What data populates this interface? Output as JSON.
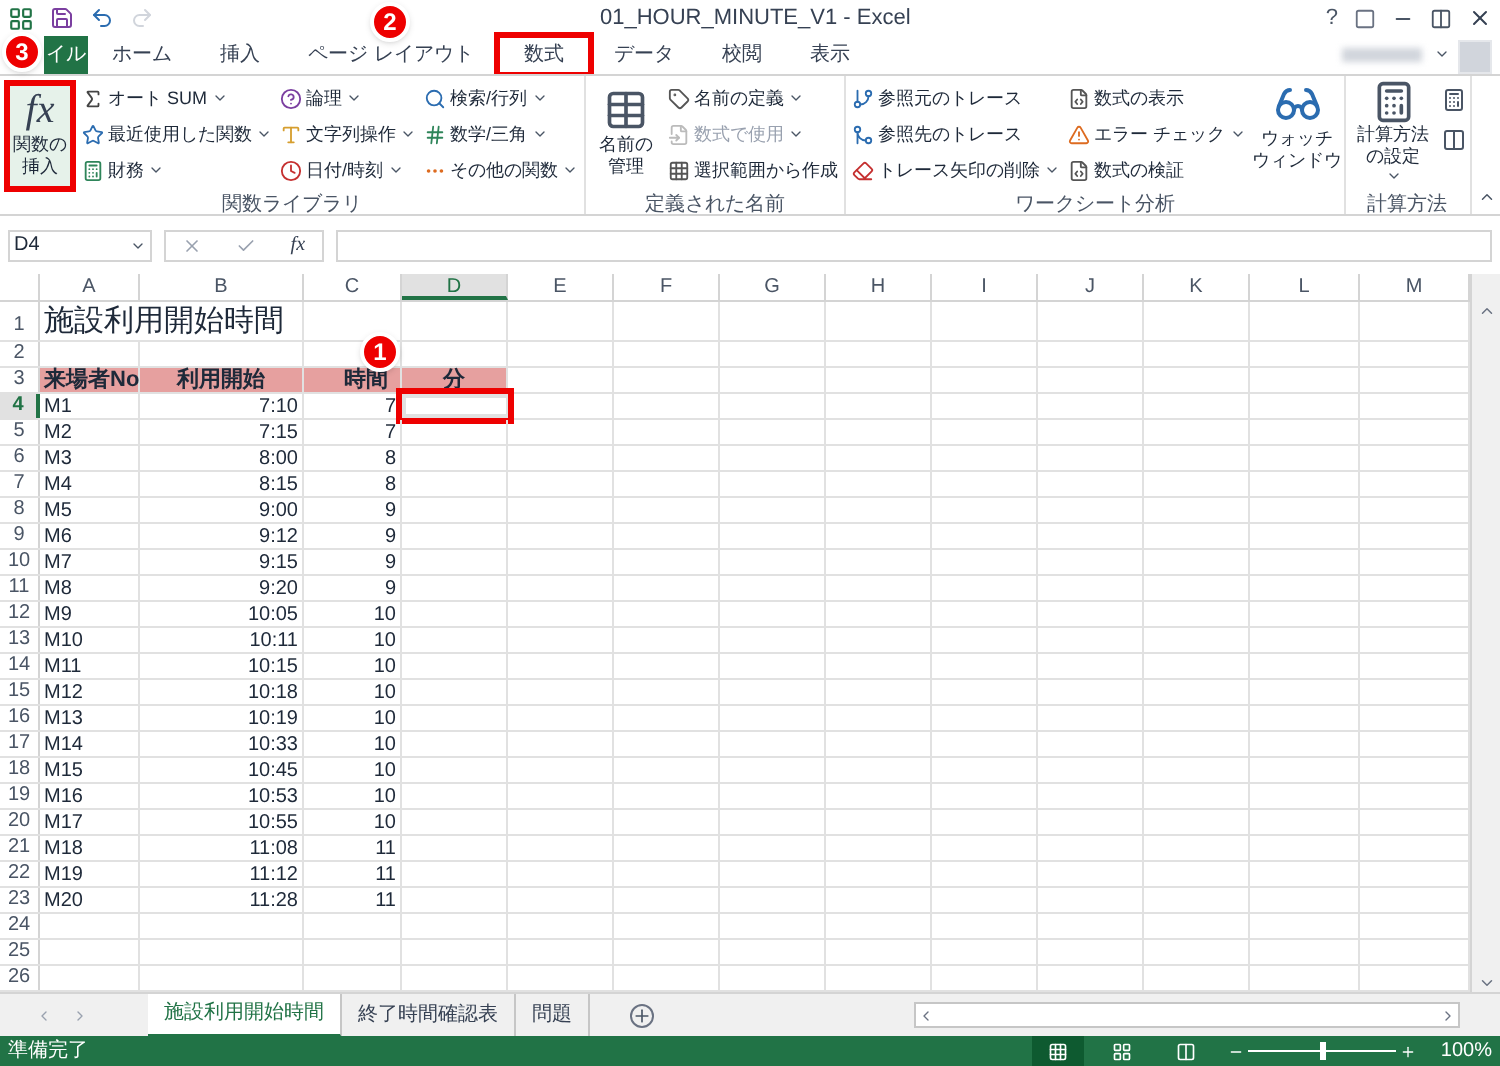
{
  "window": {
    "title": "01_HOUR_MINUTE_V1 - Excel",
    "help": "?"
  },
  "ribbon": {
    "tabs": [
      {
        "label": "イル",
        "selected": false,
        "kind": "file",
        "highlighted": false
      },
      {
        "label": "ホーム",
        "selected": false,
        "kind": "tab",
        "highlighted": false
      },
      {
        "label": "挿入",
        "selected": false,
        "kind": "tab",
        "highlighted": false
      },
      {
        "label": "ページ レイアウト",
        "selected": false,
        "kind": "tab",
        "highlighted": false
      },
      {
        "label": "数式",
        "selected": true,
        "kind": "tab",
        "highlighted": true
      },
      {
        "label": "データ",
        "selected": false,
        "kind": "tab",
        "highlighted": false
      },
      {
        "label": "校閲",
        "selected": false,
        "kind": "tab",
        "highlighted": false
      },
      {
        "label": "表示",
        "selected": false,
        "kind": "tab",
        "highlighted": false
      }
    ],
    "groups": [
      {
        "label": "関数ライブラリ",
        "large": {
          "label": "関数の挿入",
          "glyph": "fx",
          "highlighted": true
        },
        "columns": [
          [
            {
              "label": "オート SUM",
              "dropdown": true,
              "disabled": false
            },
            {
              "label": "最近使用した関数",
              "dropdown": true,
              "disabled": false
            },
            {
              "label": "財務",
              "dropdown": true,
              "disabled": false
            }
          ],
          [
            {
              "label": "論理",
              "dropdown": true,
              "disabled": false
            },
            {
              "label": "文字列操作",
              "dropdown": true,
              "disabled": false
            },
            {
              "label": "日付/時刻",
              "dropdown": true,
              "disabled": false
            }
          ],
          [
            {
              "label": "検索/行列",
              "dropdown": true,
              "disabled": false
            },
            {
              "label": "数学/三角",
              "dropdown": true,
              "disabled": false
            },
            {
              "label": "その他の関数",
              "dropdown": true,
              "disabled": false
            }
          ]
        ]
      },
      {
        "label": "定義された名前",
        "large": {
          "label": "名前の管理"
        },
        "columns": [
          [
            {
              "label": "名前の定義",
              "dropdown": true,
              "disabled": false
            },
            {
              "label": "数式で使用",
              "dropdown": true,
              "disabled": true
            },
            {
              "label": "選択範囲から作成",
              "dropdown": false,
              "disabled": false
            }
          ]
        ]
      },
      {
        "label": "ワークシート分析",
        "columns": [
          [
            {
              "label": "参照元のトレース",
              "dropdown": false,
              "disabled": false
            },
            {
              "label": "参照先のトレース",
              "dropdown": false,
              "disabled": false
            },
            {
              "label": "トレース矢印の削除",
              "dropdown": true,
              "disabled": false
            }
          ],
          [
            {
              "label": "数式の表示",
              "dropdown": false,
              "disabled": false
            },
            {
              "label": "エラー チェック",
              "dropdown": true,
              "disabled": false
            },
            {
              "label": "数式の検証",
              "dropdown": false,
              "disabled": false
            }
          ]
        ],
        "large_after": {
          "lines": [
            "ウォッチ",
            "ウィンドウ"
          ]
        }
      },
      {
        "label": "計算方法",
        "large": {
          "label": "計算方法の設定",
          "dropdown": true
        }
      }
    ]
  },
  "formula_bar": {
    "name_box": "D4",
    "function_button": "fx"
  },
  "sheet": {
    "columns": [
      {
        "label": "A",
        "selected": false
      },
      {
        "label": "B",
        "selected": false
      },
      {
        "label": "C",
        "selected": false
      },
      {
        "label": "D",
        "selected": true
      },
      {
        "label": "E",
        "selected": false
      },
      {
        "label": "F",
        "selected": false
      },
      {
        "label": "G",
        "selected": false
      },
      {
        "label": "H",
        "selected": false
      },
      {
        "label": "I",
        "selected": false
      },
      {
        "label": "J",
        "selected": false
      },
      {
        "label": "K",
        "selected": false
      },
      {
        "label": "L",
        "selected": false
      },
      {
        "label": "M",
        "selected": false
      }
    ],
    "rows": [
      {
        "number": "1",
        "selected": false,
        "kind": "title",
        "cells": [
          "施設利用開始時間"
        ]
      },
      {
        "number": "2",
        "selected": false,
        "kind": "data",
        "cells": []
      },
      {
        "number": "3",
        "selected": false,
        "kind": "header",
        "cells": [
          "来場者No",
          "利用開始",
          "時間",
          "分"
        ]
      },
      {
        "number": "4",
        "selected": true,
        "kind": "data",
        "cells": [
          "M1",
          "7:10",
          "7"
        ]
      },
      {
        "number": "5",
        "selected": false,
        "kind": "data",
        "cells": [
          "M2",
          "7:15",
          "7"
        ]
      },
      {
        "number": "6",
        "selected": false,
        "kind": "data",
        "cells": [
          "M3",
          "8:00",
          "8"
        ]
      },
      {
        "number": "7",
        "selected": false,
        "kind": "data",
        "cells": [
          "M4",
          "8:15",
          "8"
        ]
      },
      {
        "number": "8",
        "selected": false,
        "kind": "data",
        "cells": [
          "M5",
          "9:00",
          "9"
        ]
      },
      {
        "number": "9",
        "selected": false,
        "kind": "data",
        "cells": [
          "M6",
          "9:12",
          "9"
        ]
      },
      {
        "number": "10",
        "selected": false,
        "kind": "data",
        "cells": [
          "M7",
          "9:15",
          "9"
        ]
      },
      {
        "number": "11",
        "selected": false,
        "kind": "data",
        "cells": [
          "M8",
          "9:20",
          "9"
        ]
      },
      {
        "number": "12",
        "selected": false,
        "kind": "data",
        "cells": [
          "M9",
          "10:05",
          "10"
        ]
      },
      {
        "number": "13",
        "selected": false,
        "kind": "data",
        "cells": [
          "M10",
          "10:11",
          "10"
        ]
      },
      {
        "number": "14",
        "selected": false,
        "kind": "data",
        "cells": [
          "M11",
          "10:15",
          "10"
        ]
      },
      {
        "number": "15",
        "selected": false,
        "kind": "data",
        "cells": [
          "M12",
          "10:18",
          "10"
        ]
      },
      {
        "number": "16",
        "selected": false,
        "kind": "data",
        "cells": [
          "M13",
          "10:19",
          "10"
        ]
      },
      {
        "number": "17",
        "selected": false,
        "kind": "data",
        "cells": [
          "M14",
          "10:33",
          "10"
        ]
      },
      {
        "number": "18",
        "selected": false,
        "kind": "data",
        "cells": [
          "M15",
          "10:45",
          "10"
        ]
      },
      {
        "number": "19",
        "selected": false,
        "kind": "data",
        "cells": [
          "M16",
          "10:53",
          "10"
        ]
      },
      {
        "number": "20",
        "selected": false,
        "kind": "data",
        "cells": [
          "M17",
          "10:55",
          "10"
        ]
      },
      {
        "number": "21",
        "selected": false,
        "kind": "data",
        "cells": [
          "M18",
          "11:08",
          "11"
        ]
      },
      {
        "number": "22",
        "selected": false,
        "kind": "data",
        "cells": [
          "M19",
          "11:12",
          "11"
        ]
      },
      {
        "number": "23",
        "selected": false,
        "kind": "data",
        "cells": [
          "M20",
          "11:28",
          "11"
        ]
      },
      {
        "number": "24",
        "selected": false,
        "kind": "data",
        "cells": []
      },
      {
        "number": "25",
        "selected": false,
        "kind": "data",
        "cells": []
      },
      {
        "number": "26",
        "selected": false,
        "kind": "data",
        "cells": []
      }
    ],
    "active_cell": {
      "highlighted": true
    }
  },
  "sheet_tabs": [
    {
      "label": "施設利用開始時間",
      "selected": true
    },
    {
      "label": "終了時間確認表",
      "selected": false
    },
    {
      "label": "問題",
      "selected": false
    }
  ],
  "status_bar": {
    "status": "準備完了",
    "views": [
      {
        "selected": true
      },
      {
        "selected": false
      },
      {
        "selected": false
      }
    ],
    "zoom": {
      "level": 0.5,
      "reading": "100%"
    }
  },
  "annotations": [
    {
      "number": "1"
    },
    {
      "number": "2"
    },
    {
      "number": "3"
    }
  ]
}
